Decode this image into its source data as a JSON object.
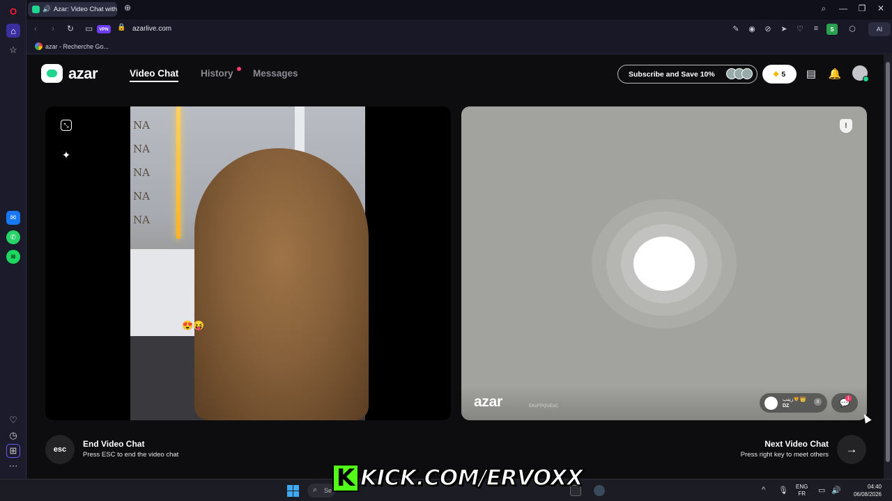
{
  "browser": {
    "tab_title": "Azar: Video Chat with",
    "url": "azarlive.com",
    "vpn_label": "VPN",
    "ai_label": "AI",
    "extension_badge": "S",
    "bookmark_label": "azar - Recherche Go..."
  },
  "app": {
    "logo_text": "azar",
    "brand_color": "#1fd48c",
    "nav": {
      "video_chat": "Video Chat",
      "history": "History",
      "messages": "Messages"
    },
    "subscribe_label": "Subscribe and Save 10%",
    "gem_count": "5"
  },
  "local_video": {
    "feed_text": "NA NA NA NA NA",
    "reactions": "😍😝"
  },
  "remote_video": {
    "logo_text": "azar",
    "session_id": "EKcFPQVEsC",
    "peer_name": "زينب🦁👑",
    "peer_country": "DZ",
    "peer_badge": "8",
    "chat_badge": "1"
  },
  "actions": {
    "esc_label": "esc",
    "end_title": "End Video Chat",
    "end_subtitle": "Press ESC to end the video chat",
    "next_title": "Next Video Chat",
    "next_subtitle": "Press right key to meet others"
  },
  "overlay": {
    "kick_letter": "K",
    "kick_text": "KICK.COM/ERVOXX"
  },
  "taskbar": {
    "search_placeholder": "Se",
    "lang_line1": "ENG",
    "lang_line2": "FR",
    "time": "04:40",
    "date": "06/08/2026"
  }
}
